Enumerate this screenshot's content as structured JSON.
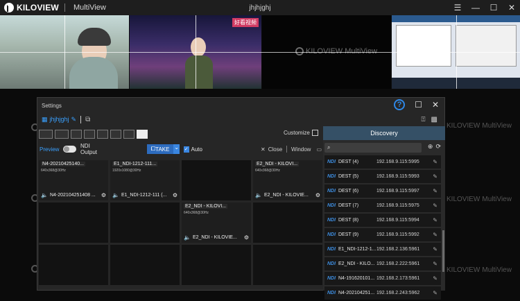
{
  "app": {
    "brand": "KILOVIEW",
    "product": "MultiView",
    "window_title": "jhjhjghj",
    "controls": [
      "☰",
      "—",
      "☐",
      "✕"
    ]
  },
  "multiview": {
    "watermark_brand": "KILOVIEW",
    "watermark_product": "MultiView"
  },
  "dialog": {
    "title": "Settings",
    "help": "?",
    "tab_name": "jhjhjghj",
    "customize": "Customize",
    "preview_label": "Preview",
    "ndi_output": "NDI Output",
    "take": "TAKE",
    "auto": "Auto",
    "close": "Close",
    "window": "Window"
  },
  "cells": [
    {
      "name": "N4-20210425140...",
      "sub": "640x368@30Hz",
      "foot": "N4-202104251408 ..."
    },
    {
      "name": "E1_NDI-1212-111...",
      "sub": "1920x1080@30Hz",
      "foot": "E1_NDI-1212-111 (..."
    },
    {
      "name": "",
      "sub": "",
      "foot": ""
    },
    {
      "name": "E2_NDI - KILOVI...",
      "sub": "640x368@30Hz",
      "foot": "E2_NDI - KILOVIE..."
    },
    {
      "name": "",
      "sub": "",
      "foot": ""
    },
    {
      "name": "",
      "sub": "",
      "foot": ""
    },
    {
      "name": "E2_NDI - KILOVI...",
      "sub": "640x368@30Hz",
      "foot": "E2_NDI - KILOVIE..."
    },
    {
      "name": "",
      "sub": "",
      "foot": ""
    },
    {
      "name": "",
      "sub": "",
      "foot": ""
    },
    {
      "name": "",
      "sub": "",
      "foot": ""
    },
    {
      "name": "",
      "sub": "",
      "foot": ""
    },
    {
      "name": "",
      "sub": "",
      "foot": ""
    }
  ],
  "discovery": {
    "title": "Discovery",
    "tag": "NDI",
    "items": [
      {
        "name": "DEST (4)",
        "ip": "192.168.9.115:5995"
      },
      {
        "name": "DEST (5)",
        "ip": "192.168.9.115:5993"
      },
      {
        "name": "DEST (6)",
        "ip": "192.168.9.115:5997"
      },
      {
        "name": "DEST (7)",
        "ip": "192.168.9.115:5975"
      },
      {
        "name": "DEST (8)",
        "ip": "192.168.9.115:5994"
      },
      {
        "name": "DEST (9)",
        "ip": "192.168.9.115:5992"
      },
      {
        "name": "E1_NDI-1212-1...",
        "ip": "192.168.2.136:5961"
      },
      {
        "name": "E2_NDI - KILO...",
        "ip": "192.168.2.222:5961"
      },
      {
        "name": "N4-191620101...",
        "ip": "192.168.2.173:5961"
      },
      {
        "name": "N4-202104251...",
        "ip": "192.168.2.243:5962"
      }
    ]
  }
}
